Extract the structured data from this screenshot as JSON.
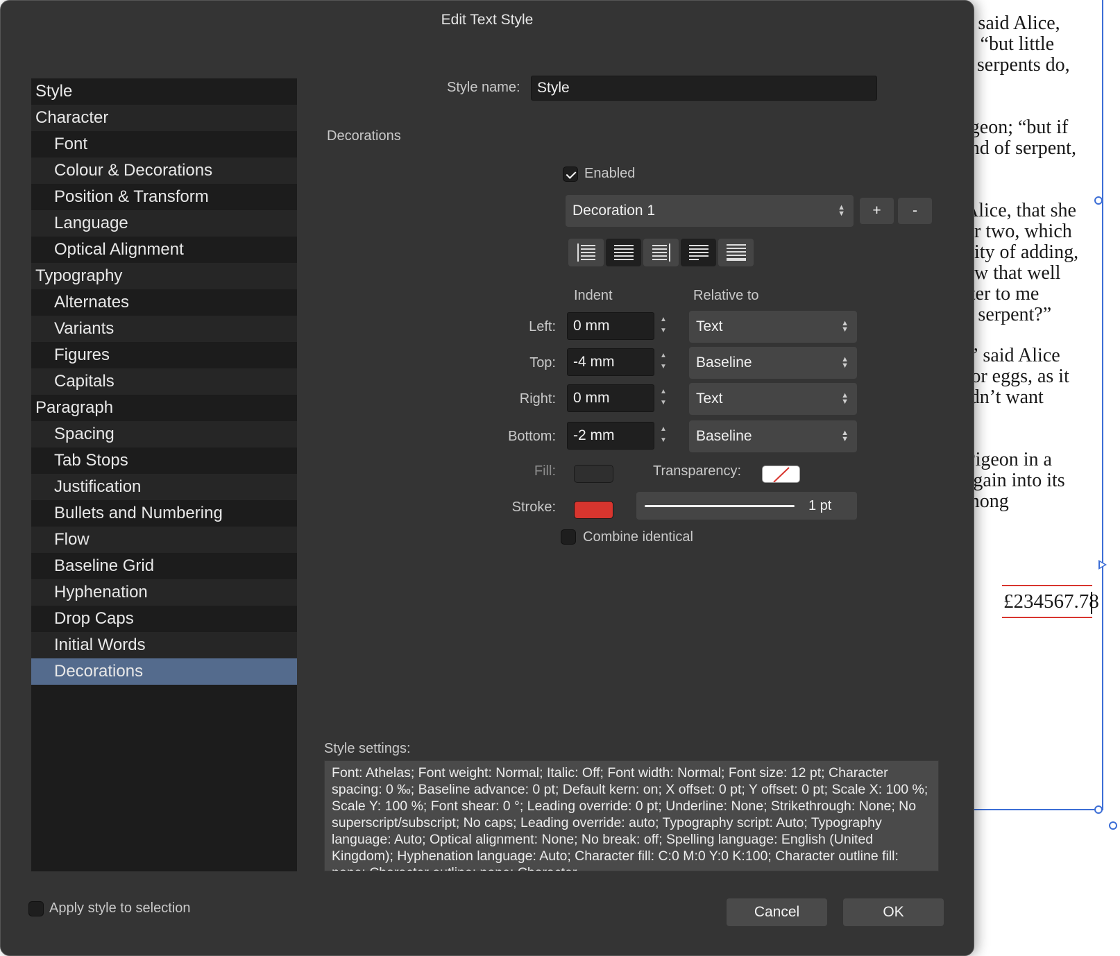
{
  "dialog": {
    "title": "Edit Text Style"
  },
  "sidebar": {
    "items": [
      {
        "label": "Style",
        "level": 0
      },
      {
        "label": "Character",
        "level": 0
      },
      {
        "label": "Font",
        "level": 1
      },
      {
        "label": "Colour & Decorations",
        "level": 1
      },
      {
        "label": "Position & Transform",
        "level": 1
      },
      {
        "label": "Language",
        "level": 1
      },
      {
        "label": "Optical Alignment",
        "level": 1
      },
      {
        "label": "Typography",
        "level": 0
      },
      {
        "label": "Alternates",
        "level": 1
      },
      {
        "label": "Variants",
        "level": 1
      },
      {
        "label": "Figures",
        "level": 1
      },
      {
        "label": "Capitals",
        "level": 1
      },
      {
        "label": "Paragraph",
        "level": 0
      },
      {
        "label": "Spacing",
        "level": 1
      },
      {
        "label": "Tab Stops",
        "level": 1
      },
      {
        "label": "Justification",
        "level": 1
      },
      {
        "label": "Bullets and Numbering",
        "level": 1
      },
      {
        "label": "Flow",
        "level": 1
      },
      {
        "label": "Baseline Grid",
        "level": 1
      },
      {
        "label": "Hyphenation",
        "level": 1
      },
      {
        "label": "Drop Caps",
        "level": 1
      },
      {
        "label": "Initial Words",
        "level": 1
      },
      {
        "label": "Decorations",
        "level": 1,
        "selected": true
      }
    ]
  },
  "style_name": {
    "label": "Style name:",
    "value": "Style"
  },
  "section_title": "Decorations",
  "enabled": {
    "label": "Enabled",
    "checked": true
  },
  "decoration_select": {
    "value": "Decoration 1"
  },
  "add_label": "+",
  "remove_label": "-",
  "alignment_buttons": [
    "align-left",
    "align-center",
    "align-right",
    "justify-last-left",
    "justify-all"
  ],
  "columns": {
    "indent": "Indent",
    "relative_to": "Relative to"
  },
  "rows": {
    "left": {
      "label": "Left:",
      "value": "0 mm",
      "relative": "Text"
    },
    "top": {
      "label": "Top:",
      "value": "-4 mm",
      "relative": "Baseline"
    },
    "right": {
      "label": "Right:",
      "value": "0 mm",
      "relative": "Text"
    },
    "bottom": {
      "label": "Bottom:",
      "value": "-2 mm",
      "relative": "Baseline"
    }
  },
  "fill": {
    "label": "Fill:"
  },
  "transparency": {
    "label": "Transparency:"
  },
  "stroke": {
    "label": "Stroke:",
    "color": "#d8352e",
    "width": "1 pt"
  },
  "combine_identical": {
    "label": "Combine identical",
    "checked": false
  },
  "style_settings": {
    "label": "Style settings:",
    "text": "Font: Athelas; Font weight: Normal; Italic: Off; Font width: Normal; Font size: 12 pt; Character spacing: 0 ‰; Baseline advance: 0 pt; Default kern: on; X offset: 0 pt; Y offset: 0 pt; Scale X: 100 %; Scale Y: 100 %; Font shear: 0 °; Leading override: 0 pt; Underline: None; Strikethrough: None; No superscript/subscript; No caps; Leading override: auto; Typography script: Auto; Typography language: Auto; Optical alignment: None; No break: off; Spelling language: English (United Kingdom); Hyphenation language: Auto; Character fill: C:0 M:0 Y:0 K:100; Character outline fill: none; Character outline: none; Character"
  },
  "apply_to_selection": {
    "label": "Apply style to selection",
    "checked": false
  },
  "buttons": {
    "cancel": "Cancel",
    "ok": "OK"
  },
  "document": {
    "lines": [
      "” said Alice,",
      "l; “but little",
      "s serpents do,",
      "igeon; “but if",
      "ind of serpent,",
      "Alice, that she",
      "or two, which",
      "nity of adding,",
      "ow that well",
      "tter to me",
      "a serpent?”",
      ",” said Alice",
      "for eggs, as it",
      "ldn’t want",
      "Pigeon in a",
      " again into its",
      "mong"
    ],
    "price": "£234567.78"
  },
  "colors": {
    "selection": "#546b8d",
    "frame": "#3c6ed6",
    "stroke": "#d8352e"
  }
}
